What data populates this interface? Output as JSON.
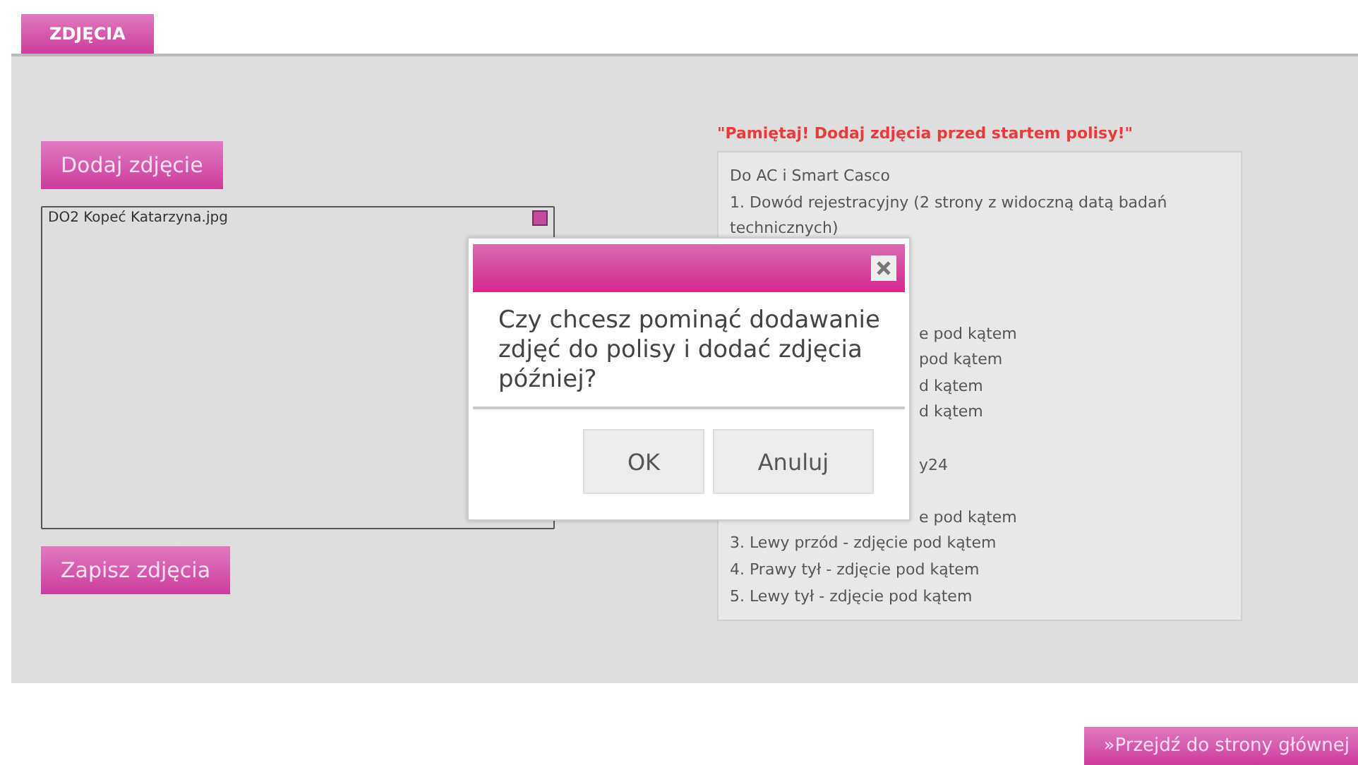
{
  "tabs": [
    {
      "label": "ZDJĘCIA",
      "selected": true
    }
  ],
  "add_button": "Dodaj zdjęcie",
  "files": [
    {
      "name": "DO2 Kopeć Katarzyna.jpg"
    }
  ],
  "save_button": "Zapisz zdjęcia",
  "reminder": "\"Pamiętaj! Dodaj zdjęcia przed startem polisy!\"",
  "info_lines": [
    {
      "kind": "full",
      "text": "Do AC i Smart Casco"
    },
    {
      "kind": "full",
      "text": "1. Dowód rejestracyjny (2 strony z widoczną datą badań technicznych)"
    },
    {
      "kind": "hidden"
    },
    {
      "kind": "hidden"
    },
    {
      "kind": "hidden"
    },
    {
      "kind": "partial",
      "text": "e pod kątem"
    },
    {
      "kind": "partial",
      "text": "pod kątem"
    },
    {
      "kind": "partial",
      "text": "d kątem"
    },
    {
      "kind": "partial",
      "text": "d kątem"
    },
    {
      "kind": "hidden"
    },
    {
      "kind": "partial",
      "text": "y24"
    },
    {
      "kind": "hidden"
    },
    {
      "kind": "partial",
      "text": "e pod kątem"
    },
    {
      "kind": "full",
      "text": "3. Lewy przód - zdjęcie pod kątem"
    },
    {
      "kind": "full",
      "text": "4. Prawy tył - zdjęcie pod kątem"
    },
    {
      "kind": "full",
      "text": "5. Lewy tył - zdjęcie pod kątem"
    }
  ],
  "dialog": {
    "message": "Czy chcesz pominąć dodawanie zdjęć do polisy i dodać zdjęcia później?",
    "buttons": [
      "OK",
      "Anuluj"
    ]
  },
  "home_link": "»Przejdź do strony głównej"
}
